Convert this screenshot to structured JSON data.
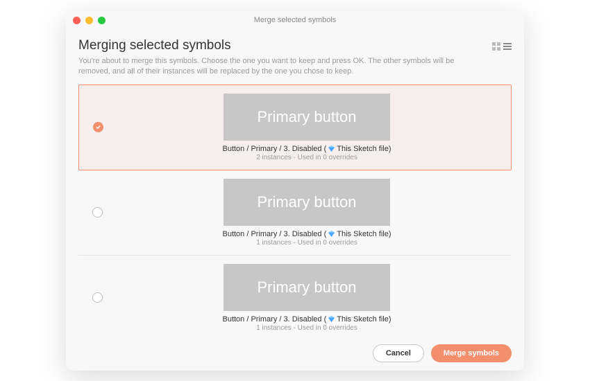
{
  "window": {
    "title": "Merge selected symbols"
  },
  "header": {
    "heading": "Merging selected symbols",
    "description": "You're about to merge this symbols. Choose the one you want to keep and press OK. The other symbols will be removed, and all of their instances will be replaced by the one you chose to keep."
  },
  "items": [
    {
      "selected": true,
      "preview_label": "Primary button",
      "path_prefix": "Button / Primary / 3. Disabled (",
      "sketch_icon": "diamond-icon",
      "path_suffix": " This Sketch file)",
      "meta": "2 instances - Used in 0 overrides"
    },
    {
      "selected": false,
      "preview_label": "Primary button",
      "path_prefix": "Button / Primary / 3. Disabled (",
      "sketch_icon": "diamond-icon",
      "path_suffix": " This Sketch file)",
      "meta": "1 instances - Used in 0 overrides"
    },
    {
      "selected": false,
      "preview_label": "Primary button",
      "path_prefix": "Button / Primary / 3. Disabled (",
      "sketch_icon": "diamond-icon",
      "path_suffix": " This Sketch file)",
      "meta": "1 instances - Used in 0 overrides"
    }
  ],
  "footer": {
    "cancel_label": "Cancel",
    "merge_label": "Merge symbols"
  },
  "colors": {
    "accent": "#f48f6d"
  }
}
